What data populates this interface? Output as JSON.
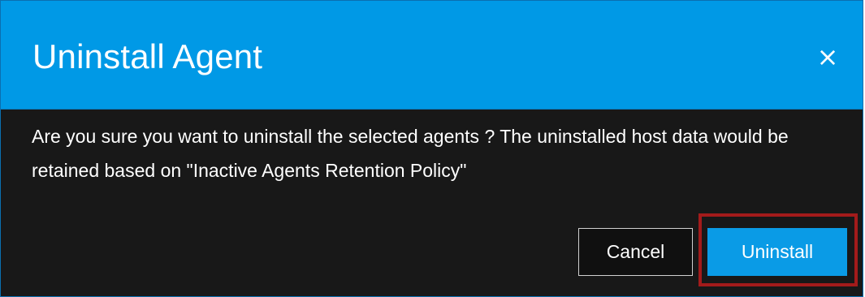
{
  "dialog": {
    "title": "Uninstall Agent",
    "close_glyph": "×",
    "message": "Are you sure you want to uninstall the selected agents ? The uninstalled host data would be retained based on \"Inactive Agents Retention Policy\"",
    "buttons": {
      "cancel_label": "Cancel",
      "uninstall_label": "Uninstall"
    }
  },
  "colors": {
    "header": "#0099e6",
    "body": "#181818",
    "primary_button": "#0a9be6",
    "highlight": "#a31b1b"
  },
  "icons": {
    "close": "close-icon"
  }
}
